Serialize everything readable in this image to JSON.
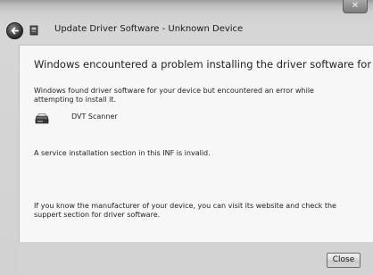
{
  "window": {
    "close_glyph": "✕"
  },
  "header": {
    "title": "Update Driver Software - Unknown Device"
  },
  "content": {
    "heading": "Windows encountered a problem installing the driver software for your device",
    "description": "Windows found driver software for your device but encountered an error while attempting to install it.",
    "device_name": "DVT Scanner",
    "error_message": "A service installation section in this INF is invalid.",
    "help_text": "If you know the manufacturer of your device, you can visit its website and check the suppert section for driver software."
  },
  "footer": {
    "close_label": "Close"
  },
  "icons": {
    "back": "back-arrow-icon",
    "wizard": "device-wizard-icon",
    "device": "scanner-icon"
  }
}
